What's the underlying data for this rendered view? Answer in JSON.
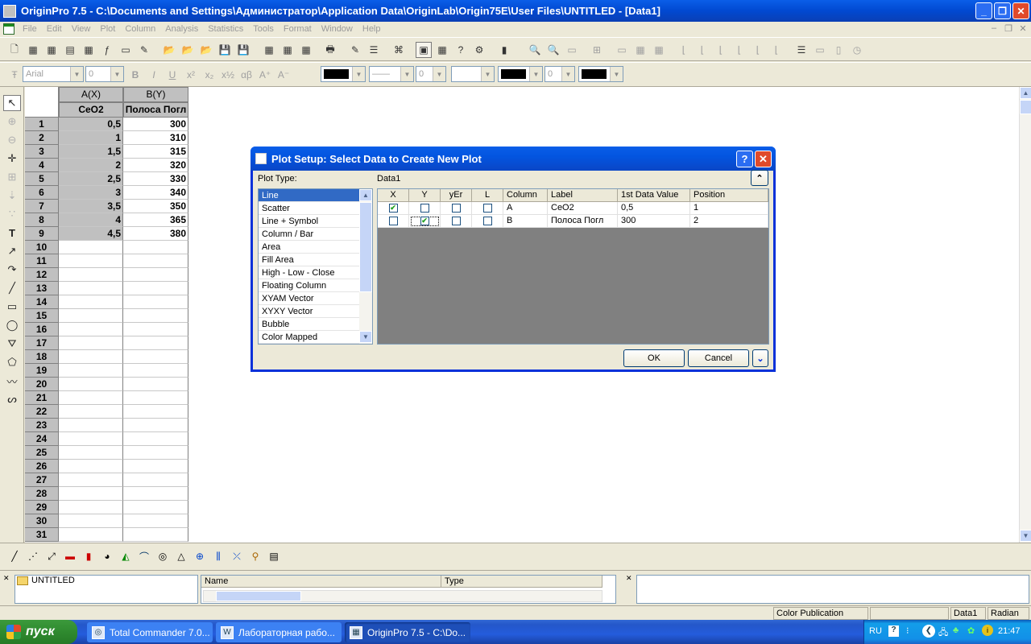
{
  "window": {
    "title": "OriginPro 7.5 - C:\\Documents and Settings\\Администратор\\Application Data\\OriginLab\\Origin75E\\User Files\\UNTITLED - [Data1]"
  },
  "menu": [
    "File",
    "Edit",
    "View",
    "Plot",
    "Column",
    "Analysis",
    "Statistics",
    "Tools",
    "Format",
    "Window",
    "Help"
  ],
  "format_toolbar": {
    "font": "Arial",
    "size": "0",
    "line_width": "0",
    "pattern_width": "0"
  },
  "worksheet": {
    "col_a_header": "A(X)",
    "col_b_header": "B(Y)",
    "col_a_name": "CeO2",
    "col_b_name": "Полоса Погл",
    "rows": [
      {
        "n": "1",
        "a": "0,5",
        "b": "300"
      },
      {
        "n": "2",
        "a": "1",
        "b": "310"
      },
      {
        "n": "3",
        "a": "1,5",
        "b": "315"
      },
      {
        "n": "4",
        "a": "2",
        "b": "320"
      },
      {
        "n": "5",
        "a": "2,5",
        "b": "330"
      },
      {
        "n": "6",
        "a": "3",
        "b": "340"
      },
      {
        "n": "7",
        "a": "3,5",
        "b": "350"
      },
      {
        "n": "8",
        "a": "4",
        "b": "365"
      },
      {
        "n": "9",
        "a": "4,5",
        "b": "380"
      },
      {
        "n": "10",
        "a": "",
        "b": ""
      },
      {
        "n": "11",
        "a": "",
        "b": ""
      },
      {
        "n": "12",
        "a": "",
        "b": ""
      },
      {
        "n": "13",
        "a": "",
        "b": ""
      },
      {
        "n": "14",
        "a": "",
        "b": ""
      },
      {
        "n": "15",
        "a": "",
        "b": ""
      },
      {
        "n": "16",
        "a": "",
        "b": ""
      },
      {
        "n": "17",
        "a": "",
        "b": ""
      },
      {
        "n": "18",
        "a": "",
        "b": ""
      },
      {
        "n": "19",
        "a": "",
        "b": ""
      },
      {
        "n": "20",
        "a": "",
        "b": ""
      },
      {
        "n": "21",
        "a": "",
        "b": ""
      },
      {
        "n": "22",
        "a": "",
        "b": ""
      },
      {
        "n": "23",
        "a": "",
        "b": ""
      },
      {
        "n": "24",
        "a": "",
        "b": ""
      },
      {
        "n": "25",
        "a": "",
        "b": ""
      },
      {
        "n": "26",
        "a": "",
        "b": ""
      },
      {
        "n": "27",
        "a": "",
        "b": ""
      },
      {
        "n": "28",
        "a": "",
        "b": ""
      },
      {
        "n": "29",
        "a": "",
        "b": ""
      },
      {
        "n": "30",
        "a": "",
        "b": ""
      },
      {
        "n": "31",
        "a": "",
        "b": ""
      }
    ]
  },
  "dialog": {
    "title": "Plot Setup: Select Data to Create New Plot",
    "help_label": "?",
    "close_label": "✕",
    "plot_type_label": "Plot Type:",
    "dataset_label": "Data1",
    "collapse_label": "⌃",
    "plot_types": [
      "Line",
      "Scatter",
      "Line + Symbol",
      "Column / Bar",
      "Area",
      "Fill Area",
      "High - Low - Close",
      "Floating Column",
      "XYAM Vector",
      "XYXY Vector",
      "Bubble",
      "Color Mapped"
    ],
    "selected_plot_type": "Line",
    "grid_headers": [
      "X",
      "Y",
      "yEr",
      "L",
      "Column",
      "Label",
      "1st Data Value",
      "Position"
    ],
    "grid_rows": [
      {
        "x": true,
        "y": false,
        "yerr": false,
        "l": false,
        "column": "A",
        "label": "CeO2",
        "first": "0,5",
        "position": "1"
      },
      {
        "x": false,
        "y": true,
        "yerr": false,
        "l": false,
        "column": "B",
        "label": "Полоса Погл",
        "first": "300",
        "position": "2"
      }
    ],
    "ok_label": "OK",
    "cancel_label": "Cancel",
    "expand_label": "⌄"
  },
  "explorer": {
    "folder": "UNTITLED",
    "list_headers": [
      "Name",
      "Type"
    ]
  },
  "statusbar": {
    "mode": "Color Publication",
    "active": "Data1",
    "angle": "Radian"
  },
  "taskbar": {
    "start_label": "пуск",
    "tasks": [
      "Total Commander 7.0...",
      "Лабораторная рабо...",
      "OriginPro 7.5 - C:\\Do..."
    ],
    "lang": "RU",
    "clock": "21:47"
  },
  "colors": {
    "accent": "#0a5ee8",
    "selection": "#316ac5",
    "grid_bg": "#808080"
  }
}
